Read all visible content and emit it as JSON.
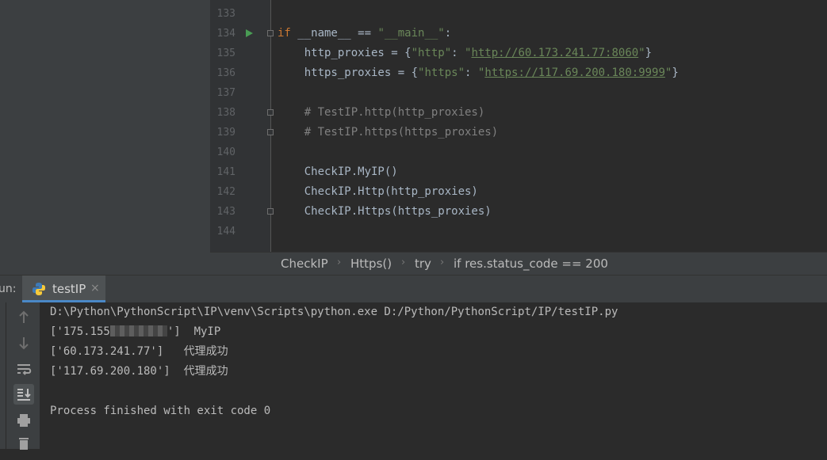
{
  "editor": {
    "lines": [
      {
        "num": "133"
      },
      {
        "num": "134",
        "kw": "if",
        "p1": " __name__ == ",
        "s1": "\"__main__\"",
        "p2": ":"
      },
      {
        "num": "135",
        "p1": "    http_proxies = {",
        "s1": "\"http\"",
        "p2": ": ",
        "s2": "\"",
        "u": "http://60.173.241.77:8060",
        "s3": "\"",
        "p3": "}"
      },
      {
        "num": "136",
        "p1": "    https_proxies = {",
        "s1": "\"https\"",
        "p2": ": ",
        "s2": "\"",
        "u": "https://117.69.200.180:9999",
        "s3": "\"",
        "p3": "}"
      },
      {
        "num": "137"
      },
      {
        "num": "138",
        "c": "    # TestIP.http(http_proxies)"
      },
      {
        "num": "139",
        "c": "    # TestIP.https(https_proxies)"
      },
      {
        "num": "140"
      },
      {
        "num": "141",
        "p1": "    CheckIP.MyIP()"
      },
      {
        "num": "142",
        "p1": "    CheckIP.Http(http_proxies)"
      },
      {
        "num": "143",
        "p1": "    CheckIP.Https(https_proxies)"
      },
      {
        "num": "144"
      }
    ]
  },
  "breadcrumb": [
    "CheckIP",
    "Https()",
    "try",
    "if res.status_code == 200"
  ],
  "run_panel": {
    "label": "un:",
    "tab_label": "testIP",
    "tab_close": "×",
    "icons": [
      "arrow-up-icon",
      "arrow-down-icon",
      "soft-wrap-icon",
      "scroll-to-end-icon",
      "print-icon",
      "trash-icon"
    ],
    "output": {
      "cmd": "D:\\Python\\PythonScript\\IP\\venv\\Scripts\\python.exe D:/Python/PythonScript/IP/testIP.py",
      "line1_prefix": "['175.155",
      "line1_suffix": "']  ",
      "line1_msg": "MyIP",
      "line2_prefix": "['60.173.241.77']   ",
      "line2_msg": "代理成功",
      "line3_prefix": "['117.69.200.180']  ",
      "line3_msg": "代理成功",
      "finish": "Process finished with exit code 0"
    }
  },
  "colors": {
    "keyword": "#cc7832",
    "string": "#6a8759",
    "comment": "#808080",
    "text": "#a9b7c6",
    "run_icon": "#499c54",
    "tab_accent": "#4a88c7"
  }
}
